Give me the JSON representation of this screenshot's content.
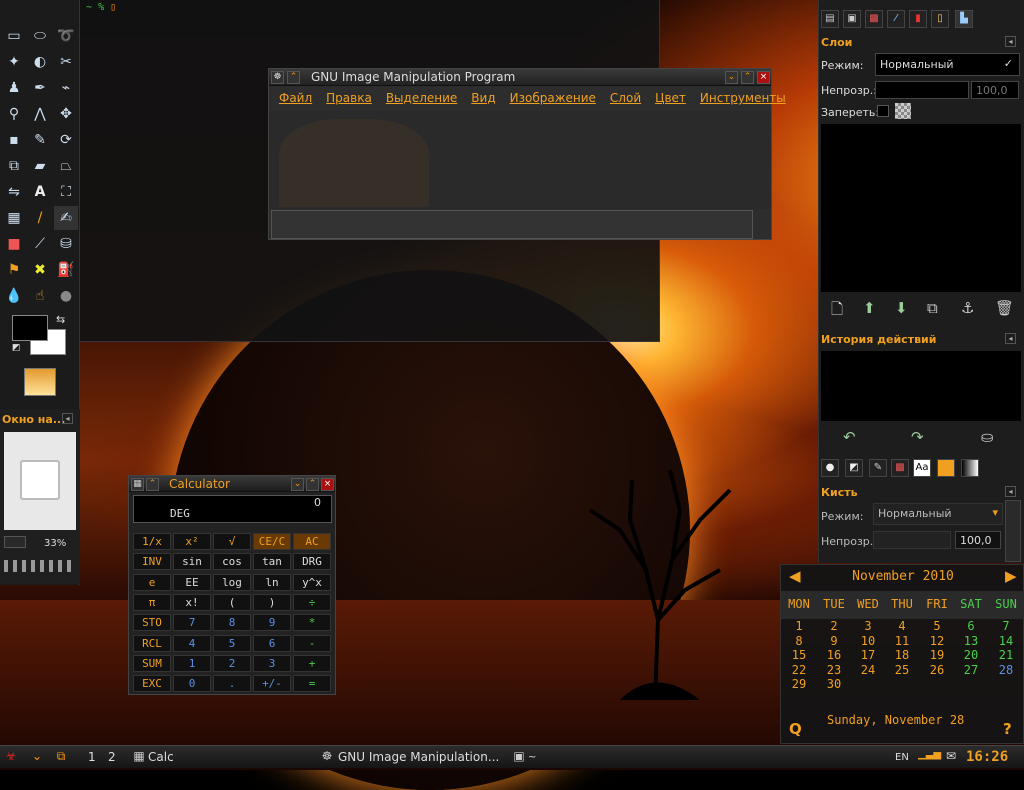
{
  "terminal": {
    "prompt": "~",
    "prompt_symbol": "%"
  },
  "gimp_window": {
    "title": "GNU Image Manipulation Program",
    "menu": [
      "Файл",
      "Правка",
      "Выделение",
      "Вид",
      "Изображение",
      "Слой",
      "Цвет",
      "Инструменты"
    ]
  },
  "toolbox": {
    "navigator_title": "Окно на...",
    "zoom": "33%"
  },
  "dock": {
    "layers": {
      "title": "Слои",
      "mode_label": "Режим:",
      "mode_value": "Нормальный",
      "opacity_label": "Непрозр.:",
      "opacity_value": "100,0",
      "lock_label": "Запереть:"
    },
    "history": {
      "title": "История действий"
    },
    "brush": {
      "title": "Кисть",
      "mode_label": "Режим:",
      "mode_value": "Нормальный",
      "opacity_label": "Непрозр.:",
      "opacity_value": "100,0"
    }
  },
  "calculator": {
    "title": "Calculator",
    "display_value": "0",
    "display_mode": "DEG",
    "rows": [
      [
        "1/x",
        "x²",
        "√",
        "CE/C",
        "AC"
      ],
      [
        "INV",
        "sin",
        "cos",
        "tan",
        "DRG"
      ],
      [
        "e",
        "EE",
        "log",
        "ln",
        "y^x"
      ],
      [
        "π",
        "x!",
        "(",
        ")",
        "÷"
      ],
      [
        "STO",
        "7",
        "8",
        "9",
        "*"
      ],
      [
        "RCL",
        "4",
        "5",
        "6",
        "-"
      ],
      [
        "SUM",
        "1",
        "2",
        "3",
        "+"
      ],
      [
        "EXC",
        "0",
        ".",
        "+/-",
        "="
      ]
    ]
  },
  "calendar": {
    "month_title": "November 2010",
    "weekdays": [
      "MON",
      "TUE",
      "WED",
      "THU",
      "FRI",
      "SAT",
      "SUN"
    ],
    "weeks": [
      [
        "1",
        "2",
        "3",
        "4",
        "5",
        "6",
        "7"
      ],
      [
        "8",
        "9",
        "10",
        "11",
        "12",
        "13",
        "14"
      ],
      [
        "15",
        "16",
        "17",
        "18",
        "19",
        "20",
        "21"
      ],
      [
        "22",
        "23",
        "24",
        "25",
        "26",
        "27",
        "28"
      ],
      [
        "29",
        "30",
        "",
        "",
        "",
        "",
        ""
      ]
    ],
    "selected_date": "Sunday, November 28",
    "colors": {
      "weekday": "#f0a020",
      "saturday": "#4ccf4c",
      "sunday": "#4ccf4c",
      "today": "#5b8fe6"
    }
  },
  "taskbar": {
    "workspaces": [
      "1",
      "2"
    ],
    "tasks": [
      "Calc",
      "GNU Image Manipulation...",
      "~"
    ],
    "layout": "EN",
    "clock": "16:26"
  }
}
